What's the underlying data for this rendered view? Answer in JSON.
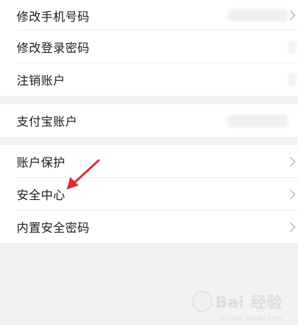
{
  "group1": {
    "items": [
      {
        "label": "修改手机号码"
      },
      {
        "label": "修改登录密码"
      },
      {
        "label": "注销账户"
      }
    ]
  },
  "group2": {
    "items": [
      {
        "label": "支付宝账户"
      }
    ]
  },
  "group3": {
    "items": [
      {
        "label": "账户保护"
      },
      {
        "label": "安全中心"
      },
      {
        "label": "内置安全密码"
      }
    ]
  },
  "watermark": {
    "text": "Bai 经验",
    "sub": "jingyan.baidu.com"
  },
  "colors": {
    "background": "#f2f2f2",
    "card": "#ffffff",
    "text": "#1a1a1a",
    "chevron": "#9a9a9a",
    "annotation_arrow": "#e8262d"
  }
}
